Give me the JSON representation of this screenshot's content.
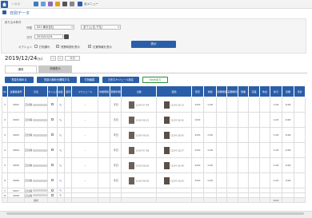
{
  "app": {
    "title": "日別データ",
    "toolbar": {
      "back_label": "< 戻る",
      "menu_label": "全メニュー"
    }
  },
  "filters": {
    "header": "絞り込み条件",
    "org_label": "所属",
    "org_value": "001 東京支社",
    "org_scope_value": "全て(上位,下位)",
    "date_label": "日付",
    "date_value": "2019/12/24",
    "option_label": "オプション",
    "opt1_label": "打刻漏れ",
    "opt2_label": "残業時間を表示",
    "opt3_label": "位置情報を表示",
    "show_button": "表示"
  },
  "date_nav": {
    "current": "2019/12/24",
    "weekday": "(火)",
    "today_label": "今日"
  },
  "tabs": [
    {
      "label": "通常",
      "active": true
    },
    {
      "label": "詳細表示",
      "active": false
    }
  ],
  "actions": {
    "btn1": "勤怠を締める",
    "btn2": "勤怠の締めを解除する",
    "btn3": "打刻編集",
    "btn4": "日別スケジュール設定",
    "btn5": "Excel出力"
  },
  "table": {
    "headers": [
      "No",
      "従業員番号",
      "氏名",
      "タイムカード",
      "編集",
      "遅刻",
      "スケジュール",
      "休憩時間",
      "勤務状態",
      "出勤",
      "退勤",
      "所定",
      "休憩",
      "労働時間",
      "実働時間",
      "残業",
      "深夜",
      "休出",
      "休日",
      "労働",
      "月計"
    ],
    "rows": [
      {
        "no": "1",
        "id": "0001",
        "name": "正社員",
        "status": "平日",
        "in": "12/24 07:44",
        "out": "12/24 18:13",
        "sched": "9:00",
        "rest": "1:00",
        "total": "1.00",
        "act": "9:00"
      },
      {
        "no": "2",
        "id": "0002",
        "name": "正社員",
        "status": "平日",
        "in": "12/24 08:12",
        "out": "12/24 18:35",
        "sched": "9:00",
        "rest": "",
        "total": "1.00",
        "act": "9:00"
      },
      {
        "no": "3",
        "id": "0003",
        "name": "正社員",
        "status": "平日",
        "in": "12/24 08:01",
        "out": "12/24 18:05",
        "sched": "9:00",
        "rest": "1:00",
        "total": "1.00",
        "act": "9:00"
      },
      {
        "no": "4",
        "id": "0004",
        "name": "正社員",
        "status": "平日",
        "in": "12/24 07:58",
        "out": "12/24 18:27",
        "sched": "9:00",
        "rest": "1:00",
        "total": "1.00",
        "act": "9:00"
      },
      {
        "no": "5",
        "id": "0005",
        "name": "正社員",
        "status": "平日",
        "in": "12/24 08:20",
        "out": "12/24 18:40",
        "sched": "9:00",
        "rest": "1:00",
        "total": "1.00",
        "act": "9:00"
      },
      {
        "no": "6",
        "id": "0006",
        "name": "正社員",
        "status": "平日",
        "in": "12/24 08:05",
        "out": "12/24 18:02",
        "sched": "9:00",
        "rest": "1:00",
        "total": "1.00",
        "act": "9:00"
      }
    ],
    "short_rows": [
      {
        "no": "7",
        "id": "0007",
        "name": "正社員"
      },
      {
        "no": "8",
        "id": "0008",
        "name": "正社員"
      }
    ],
    "total_label": "合計",
    "total_value": "6.00"
  }
}
